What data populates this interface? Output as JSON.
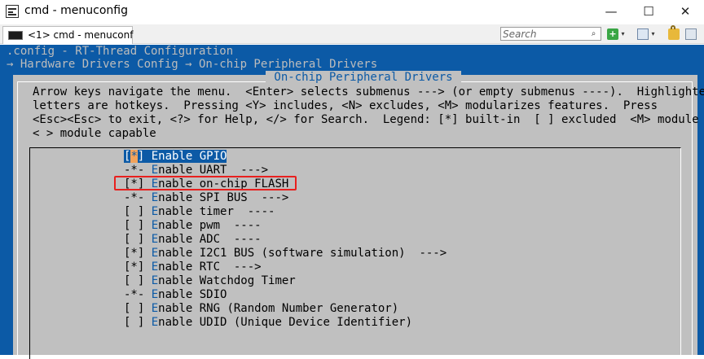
{
  "window": {
    "title": "cmd - menuconfig",
    "minimize_glyph": "—",
    "maximize_glyph": "☐",
    "close_glyph": "✕"
  },
  "toolbar": {
    "tab_label": "<1>  cmd - menuconf",
    "search_placeholder": "Search",
    "search_button_glyph": "⌕",
    "add_glyph": "+",
    "dropdown_glyph": "▾",
    "icons": [
      "console-icon",
      "search-icon",
      "add-tab-icon",
      "view-icon",
      "lock-icon",
      "grid-icon"
    ]
  },
  "terminal": {
    "crumb_config": ".config - RT-Thread Configuration",
    "crumb_path": "→ Hardware Drivers Config → On-chip Peripheral Drivers",
    "dialog_title": " On-chip Peripheral Drivers ",
    "help_lines": [
      "Arrow keys navigate the menu.  <Enter> selects submenus ---> (or empty submenus ----).  Highlighted",
      "letters are hotkeys.  Pressing <Y> includes, <N> excludes, <M> modularizes features.  Press",
      "<Esc><Esc> to exit, <?> for Help, </> for Search.  Legend: [*] built-in  [ ] excluded  <M> module",
      "< > module capable"
    ],
    "items": [
      {
        "prefix": "[",
        "mark": "*",
        "suffix": "] ",
        "hotkey": "E",
        "rest": "nable GPIO",
        "selected": true
      },
      {
        "prefix": "-*- ",
        "mark": "",
        "suffix": "",
        "hotkey": "E",
        "rest": "nable UART  --->",
        "selected": false
      },
      {
        "prefix": "[*] ",
        "mark": "",
        "suffix": "",
        "hotkey": "E",
        "rest": "nable on-chip FLASH",
        "selected": false
      },
      {
        "prefix": "-*- ",
        "mark": "",
        "suffix": "",
        "hotkey": "E",
        "rest": "nable SPI BUS  --->",
        "selected": false
      },
      {
        "prefix": "[ ] ",
        "mark": "",
        "suffix": "",
        "hotkey": "E",
        "rest": "nable timer  ----",
        "selected": false
      },
      {
        "prefix": "[ ] ",
        "mark": "",
        "suffix": "",
        "hotkey": "E",
        "rest": "nable pwm  ----",
        "selected": false
      },
      {
        "prefix": "[ ] ",
        "mark": "",
        "suffix": "",
        "hotkey": "E",
        "rest": "nable ADC  ----",
        "selected": false
      },
      {
        "prefix": "[*] ",
        "mark": "",
        "suffix": "",
        "hotkey": "E",
        "rest": "nable I2C1 BUS (software simulation)  --->",
        "selected": false
      },
      {
        "prefix": "[*] ",
        "mark": "",
        "suffix": "",
        "hotkey": "E",
        "rest": "nable RTC  --->",
        "selected": false
      },
      {
        "prefix": "[ ] ",
        "mark": "",
        "suffix": "",
        "hotkey": "E",
        "rest": "nable Watchdog Timer",
        "selected": false
      },
      {
        "prefix": "-*- ",
        "mark": "",
        "suffix": "",
        "hotkey": "E",
        "rest": "nable SDIO",
        "selected": false
      },
      {
        "prefix": "[ ] ",
        "mark": "",
        "suffix": "",
        "hotkey": "E",
        "rest": "nable RNG (Random Number Generator)",
        "selected": false
      },
      {
        "prefix": "[ ] ",
        "mark": "",
        "suffix": "",
        "hotkey": "E",
        "rest": "nable UDID (Unique Device Identifier)",
        "selected": false
      }
    ],
    "annotation_color": "#e8201e",
    "background_color": "#0c5aa6",
    "dialog_color": "#c0c0c0"
  }
}
